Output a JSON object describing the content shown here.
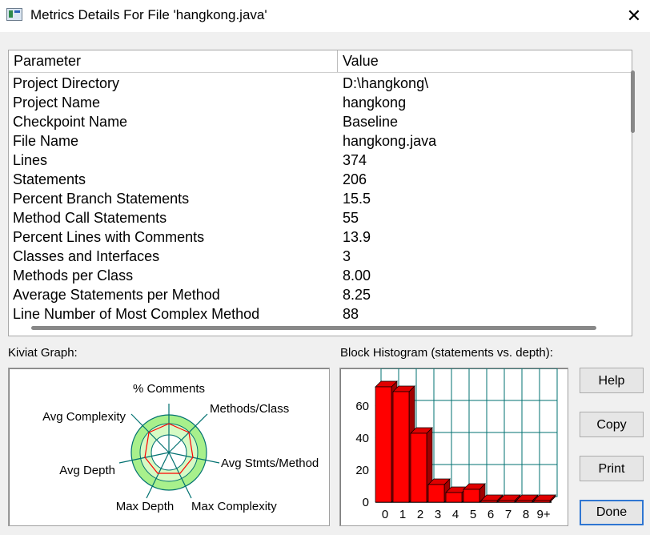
{
  "window": {
    "title": "Metrics Details For File 'hangkong.java'",
    "close_label": "✕"
  },
  "table": {
    "headers": [
      "Parameter",
      "Value"
    ],
    "rows": [
      [
        "Project Directory",
        "D:\\hangkong\\"
      ],
      [
        "Project Name",
        "hangkong"
      ],
      [
        "Checkpoint Name",
        "Baseline"
      ],
      [
        "File Name",
        "hangkong.java"
      ],
      [
        "Lines",
        "374"
      ],
      [
        "Statements",
        "206"
      ],
      [
        "Percent Branch Statements",
        "15.5"
      ],
      [
        "Method Call Statements",
        "55"
      ],
      [
        "Percent Lines with Comments",
        "13.9"
      ],
      [
        "Classes and Interfaces",
        "3"
      ],
      [
        "Methods per Class",
        "8.00"
      ],
      [
        "Average Statements per Method",
        "8.25"
      ],
      [
        "Line Number of Most Complex Method",
        "88"
      ]
    ]
  },
  "kiviat": {
    "title": "Kiviat Graph:",
    "axes": [
      "% Comments",
      "Methods/Class",
      "Avg Stmts/Method",
      "Max Complexity",
      "Max Depth",
      "Avg Depth",
      "Avg Complexity"
    ],
    "colors": {
      "outer_ring": "#a8f08c",
      "inner_ring": "#d6fac4",
      "spokes": "#007070",
      "polygon": "#ff0000"
    }
  },
  "histogram": {
    "title": "Block Histogram (statements vs. depth):",
    "chart_data": {
      "type": "bar",
      "title": "Block Histogram (statements vs. depth):",
      "categories": [
        "0",
        "1",
        "2",
        "3",
        "4",
        "5",
        "6",
        "7",
        "8",
        "9+"
      ],
      "values": [
        72,
        69,
        43,
        11,
        6,
        8,
        1,
        1,
        1,
        1
      ],
      "y_ticks": [
        0,
        20,
        40,
        60
      ],
      "ylim": [
        0,
        80
      ],
      "grid": true,
      "bar_color": "#ff0000",
      "grid_color": "#007070"
    }
  },
  "buttons": {
    "help": "Help",
    "copy": "Copy",
    "print": "Print",
    "done": "Done"
  }
}
